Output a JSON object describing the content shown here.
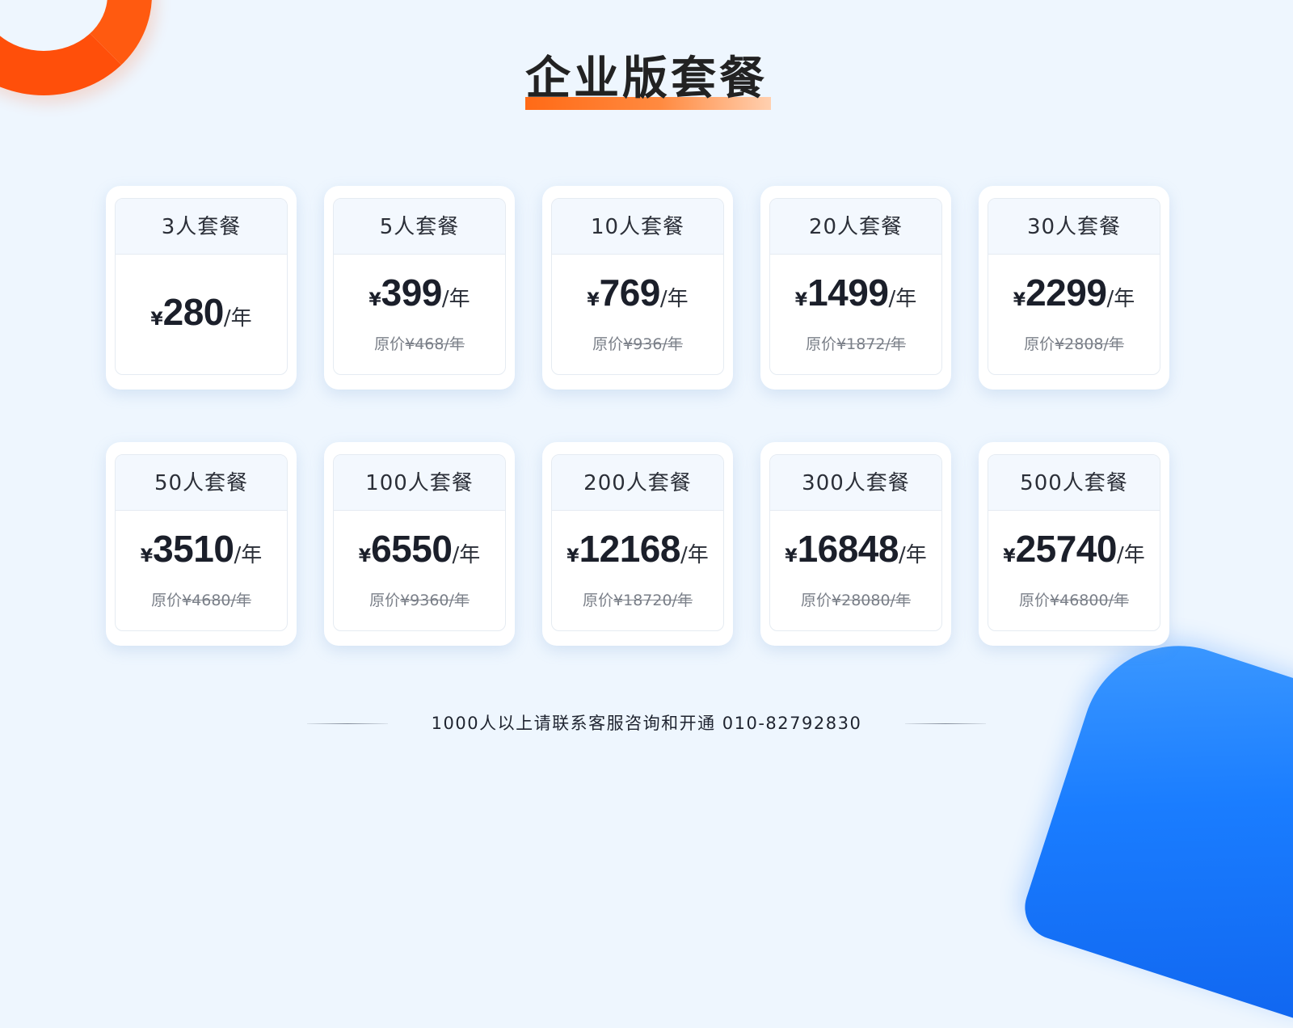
{
  "page": {
    "title": "企业版套餐",
    "colors": {
      "accent_orange": "#ff6a16",
      "accent_blue": "#1a7dff",
      "background": "#eef6fe"
    }
  },
  "plans": [
    {
      "name": "3人套餐",
      "currency": "¥",
      "price": "280",
      "unit": "/年",
      "orig_label": "",
      "orig_price": ""
    },
    {
      "name": "5人套餐",
      "currency": "¥",
      "price": "399",
      "unit": "/年",
      "orig_label": "原价",
      "orig_price": "¥468/年"
    },
    {
      "name": "10人套餐",
      "currency": "¥",
      "price": "769",
      "unit": "/年",
      "orig_label": "原价",
      "orig_price": "¥936/年"
    },
    {
      "name": "20人套餐",
      "currency": "¥",
      "price": "1499",
      "unit": "/年",
      "orig_label": "原价",
      "orig_price": "¥1872/年"
    },
    {
      "name": "30人套餐",
      "currency": "¥",
      "price": "2299",
      "unit": "/年",
      "orig_label": "原价",
      "orig_price": "¥2808/年"
    },
    {
      "name": "50人套餐",
      "currency": "¥",
      "price": "3510",
      "unit": "/年",
      "orig_label": "原价",
      "orig_price": "¥4680/年"
    },
    {
      "name": "100人套餐",
      "currency": "¥",
      "price": "6550",
      "unit": "/年",
      "orig_label": "原价",
      "orig_price": "¥9360/年"
    },
    {
      "name": "200人套餐",
      "currency": "¥",
      "price": "12168",
      "unit": "/年",
      "orig_label": "原价",
      "orig_price": "¥18720/年"
    },
    {
      "name": "300人套餐",
      "currency": "¥",
      "price": "16848",
      "unit": "/年",
      "orig_label": "原价",
      "orig_price": "¥28080/年"
    },
    {
      "name": "500人套餐",
      "currency": "¥",
      "price": "25740",
      "unit": "/年",
      "orig_label": "原价",
      "orig_price": "¥46800/年"
    }
  ],
  "footer": {
    "text": "1000人以上请联系客服咨询和开通 010-82792830"
  }
}
